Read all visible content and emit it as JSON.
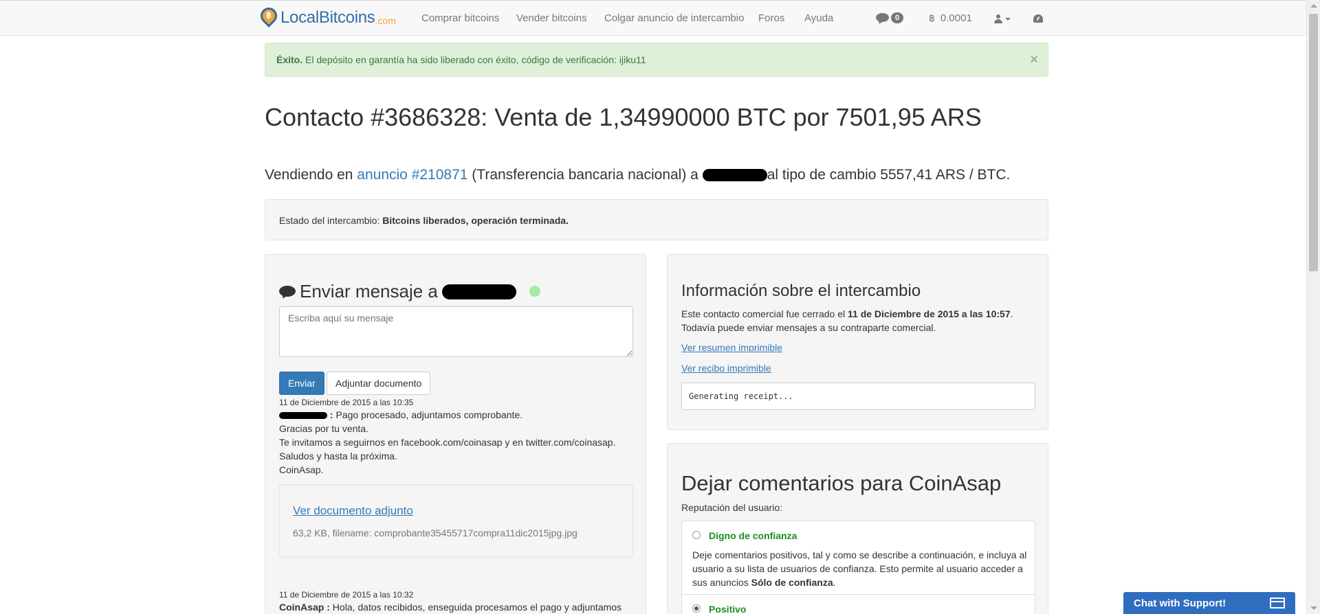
{
  "nav": {
    "brand_name": "LocalBitcoins",
    "brand_suffix": ".com",
    "brand_logo_glyph": "฿",
    "links": [
      "Comprar bitcoins",
      "Vender bitcoins",
      "Colgar anuncio de intercambio",
      "Foros",
      "Ayuda"
    ],
    "messages_count": "0",
    "btc_glyph": "฿",
    "balance": "0.0001"
  },
  "alert": {
    "strong": "Éxito.",
    "text": " El depósito en garantía ha sido liberado con éxito, código de verificación: ijiku11",
    "close": "×"
  },
  "title": "Contacto #3686328: Venta de 1,34990000 BTC por 7501,95 ARS",
  "lead": {
    "prefix": "Vendiendo en ",
    "ad_link": "anuncio #210871",
    "middle": " (Transferencia bancaria nacional) a ",
    "suffix": "al tipo de cambio 5557,41 ARS / BTC."
  },
  "status": {
    "label": "Estado del intercambio: ",
    "value": "Bitcoins liberados, operación terminada."
  },
  "message_panel": {
    "heading": "Enviar mensaje a",
    "input_placeholder": "Escriba aquí su mensaje",
    "send_label": "Enviar",
    "attach_label": "Adjuntar documento",
    "messages": [
      {
        "date": "11 de Diciembre de 2015 a las 10:35",
        "sender_sep": " :",
        "lines": [
          " Pago procesado, adjuntamos comprobante.",
          "Gracias por tu venta.",
          "Te invitamos a seguirnos en facebook.com/coinasap y en twitter.com/coinasap.",
          "Saludos y hasta la próxima.",
          "CoinAsap."
        ]
      },
      {
        "date": "11 de Diciembre de 2015 a las 10:32",
        "sender": "CoinAsap",
        "sender_sep": " :",
        "lines": [
          " Hola, datos recibidos, enseguida procesamos el pago y adjuntamos"
        ]
      }
    ],
    "attachment": {
      "link": "Ver documento adjunto",
      "meta": "63,2 KB, filename: comprobante35455717compra11dic2015jpg.jpg"
    }
  },
  "info_panel": {
    "title": "Información sobre el intercambio",
    "text_prefix": "Este contacto comercial fue cerrado el ",
    "closed_date": "11 de Diciembre de 2015 a las 10:57",
    "text_suffix": ".",
    "text_line2": "Todavía puede enviar mensajes a su contraparte comercial.",
    "link_summary": "Ver resumen imprimible",
    "link_receipt": "Ver recibo imprimible",
    "receipt_status": "Generating receipt..."
  },
  "feedback_panel": {
    "title": "Dejar comentarios para CoinAsap",
    "reputation_label": "Reputación del usuario:",
    "options": [
      {
        "name": "Digno de confianza",
        "desc_prefix": "Deje comentarios positivos, tal y como se describe a continuación, e incluya al usuario a su lista de usuarios de confianza. Esto permite al usuario acceder a sus anuncios ",
        "desc_bold": "Sólo de confianza",
        "desc_suffix": "."
      },
      {
        "name": "Positivo"
      }
    ]
  },
  "chat_support": {
    "label": "Chat with Support!"
  },
  "colors": {
    "link": "#337ab7",
    "primary": "#337ab7",
    "success_bg": "#dff0d8",
    "success_text": "#3c763d",
    "trusted_green": "#1e8c1e",
    "chat_support_bg": "#2f6dbf",
    "brand_orange": "#f0a23a"
  }
}
